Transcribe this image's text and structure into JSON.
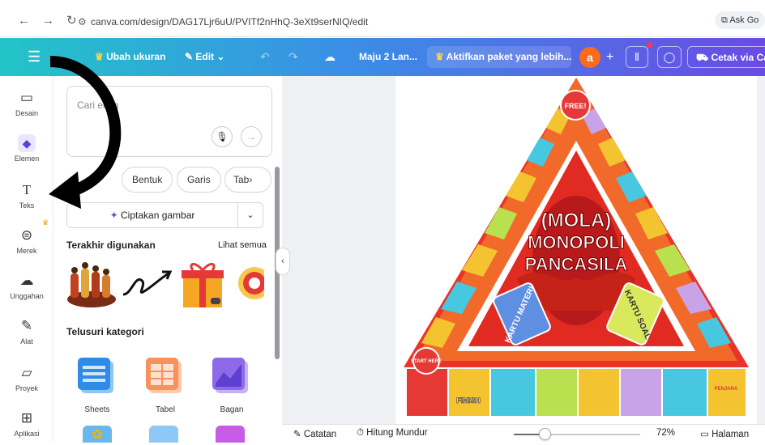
{
  "browser": {
    "url": "canva.com/design/DAG17Ljr6uU/PVITf2nHhQ-3eXt9serNIQ/edit",
    "ask_label": "Ask Go"
  },
  "topbar": {
    "resize_label": "Ubah ukuran",
    "edit_label": "Edit",
    "title": "Maju 2 Lan...",
    "upgrade_label": "Aktifkan paket yang lebih...",
    "avatar_letter": "a",
    "print_label": "Cetak via Ca",
    "colors": {
      "gradient_start": "#23c4c8",
      "gradient_end": "#6a4be4",
      "avatar": "#ff6a1a"
    }
  },
  "rail": {
    "items": [
      {
        "label": "Desain",
        "icon": "layout-icon"
      },
      {
        "label": "Elemen",
        "icon": "shapes-icon"
      },
      {
        "label": "Teks",
        "icon": "text-icon"
      },
      {
        "label": "Merek",
        "icon": "brand-icon"
      },
      {
        "label": "Unggahan",
        "icon": "upload-icon"
      },
      {
        "label": "Alat",
        "icon": "pen-icon"
      },
      {
        "label": "Proyek",
        "icon": "folder-icon"
      },
      {
        "label": "Aplikasi",
        "icon": "apps-icon"
      }
    ]
  },
  "panel": {
    "search_placeholder": "Cari elem",
    "chips": [
      "Bentuk",
      "Garis",
      "Tab"
    ],
    "create_label": "Ciptakan gambar",
    "recent_heading": "Terakhir digunakan",
    "see_all": "Lihat semua",
    "browse_heading": "Telusuri kategori",
    "categories": [
      "Sheets",
      "Tabel",
      "Bagan"
    ]
  },
  "board": {
    "line1": "(MOLA)",
    "line2": "MONOPOLI",
    "line3": "PANCASILA",
    "free": "FREE!",
    "start": "START HERE",
    "finish": "FINISH",
    "penjara": "PENJARA",
    "kartu_materi": "KARTU MATERI",
    "kartu_soal": "KARTU SOAL"
  },
  "bottombar": {
    "notes_label": "Catatan",
    "timer_label": "Hitung Mundur",
    "zoom": "72%",
    "zoom_fraction": 0.25,
    "pages_label": "Halaman"
  }
}
